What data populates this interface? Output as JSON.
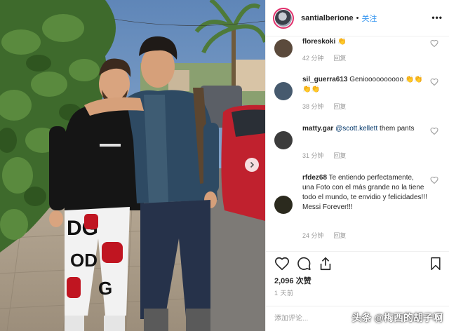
{
  "header": {
    "username": "santialberione",
    "separator": "•",
    "follow_label": "关注",
    "more_icon": "more-horizontal-icon"
  },
  "comments": [
    {
      "username": "floreskoki",
      "text": "👏",
      "time": "42 分钟",
      "reply_label": "回复",
      "avatar_color": "#5b4a3c"
    },
    {
      "username": "sil_guerra613",
      "text": "Genioooooooooo 👏👏👏👏",
      "time": "38 分钟",
      "reply_label": "回复",
      "avatar_color": "#465a6e"
    },
    {
      "username": "matty.gar",
      "mention": "@scott.kellett",
      "text": "them pants",
      "time": "31 分钟",
      "reply_label": "回复",
      "avatar_color": "#3c3c3c"
    },
    {
      "username": "rfdez68",
      "text": "Te entiendo perfectamente, una Foto con el más grande no la tiene todo el mundo, te envidio y felicidades!!! Messi Forever!!!",
      "time": "24 分钟",
      "reply_label": "回复",
      "avatar_color": "#2b2a1e"
    }
  ],
  "actions": {
    "like_icon": "heart-icon",
    "comment_icon": "comment-icon",
    "share_icon": "share-icon",
    "save_icon": "bookmark-icon",
    "likes_count": "2,096",
    "likes_label": "次赞",
    "time_ago": "1 天前"
  },
  "add_comment": {
    "placeholder": "添加评论..."
  },
  "watermark": "头条 @梅西的胡子啊",
  "colors": {
    "link_blue": "#3897f0",
    "mention_blue": "#003569",
    "meta_gray": "#999999",
    "text_dark": "#262626",
    "border": "#efefef"
  }
}
